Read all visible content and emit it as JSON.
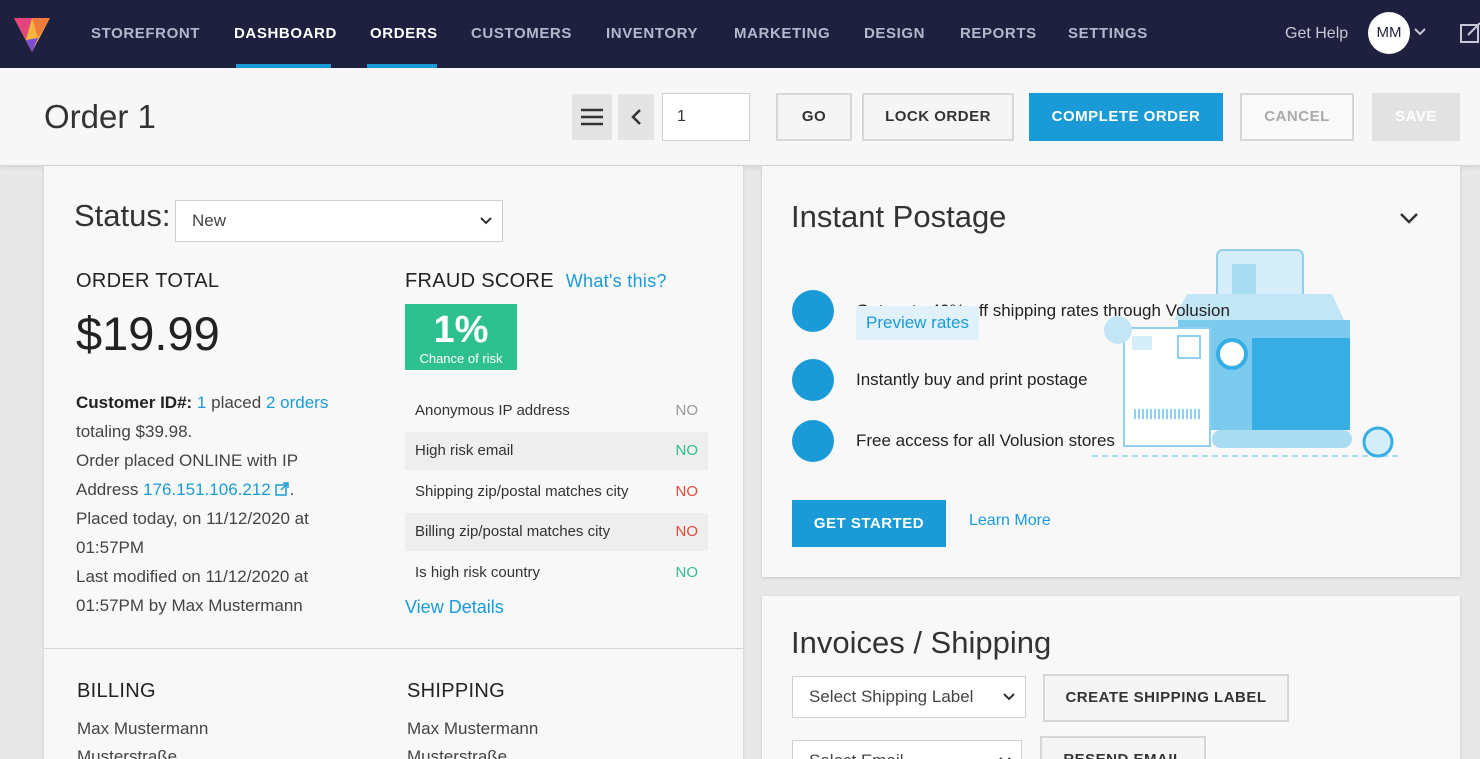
{
  "nav": {
    "items": [
      "STOREFRONT",
      "DASHBOARD",
      "ORDERS",
      "CUSTOMERS",
      "INVENTORY",
      "MARKETING",
      "DESIGN",
      "REPORTS",
      "SETTINGS"
    ],
    "get_help": "Get Help",
    "avatar_initials": "MM"
  },
  "header": {
    "title": "Order 1",
    "order_number_value": "1",
    "go": "GO",
    "lock_order": "LOCK ORDER",
    "complete_order": "COMPLETE ORDER",
    "cancel": "CANCEL",
    "save": "SAVE"
  },
  "order": {
    "status_label": "Status:",
    "status_value": "New",
    "total_heading": "ORDER TOTAL",
    "total": "$19.99",
    "customer_label": "Customer ID#:",
    "customer_id": "1",
    "placed_word": "placed",
    "orders_link": "2 orders",
    "totaling": "totaling $39.98.",
    "placed_line": "Order placed ONLINE with IP",
    "address_word": "Address",
    "ip": "176.151.106.212",
    "placed_date_1": "Placed today, on 11/12/2020 at",
    "placed_date_2": "01:57PM",
    "modified_1": "Last modified on 11/12/2020 at",
    "modified_2": "01:57PM by Max Mustermann"
  },
  "fraud": {
    "heading": "FRAUD SCORE",
    "whats_this": "What's this?",
    "percent": "1%",
    "sub": "Chance of risk",
    "rows": [
      {
        "label": "Anonymous IP address",
        "value": "NO"
      },
      {
        "label": "High risk email",
        "value": "NO"
      },
      {
        "label": "Shipping zip/postal matches city",
        "value": "NO"
      },
      {
        "label": "Billing zip/postal matches city",
        "value": "NO"
      },
      {
        "label": "Is high risk country",
        "value": "NO"
      }
    ],
    "view_details": "View Details"
  },
  "billing": {
    "heading": "BILLING",
    "name": "Max Mustermann",
    "street": "Musterstraße"
  },
  "shipping": {
    "heading": "SHIPPING",
    "name": "Max Mustermann",
    "street": "Musterstraße"
  },
  "postage": {
    "title": "Instant Postage",
    "features": [
      "Get up to 40% off shipping rates through Volusion",
      "Instantly buy and print postage",
      "Free access for all Volusion stores"
    ],
    "preview_rates": "Preview rates",
    "get_started": "GET STARTED",
    "learn_more": "Learn More"
  },
  "invoices": {
    "title": "Invoices / Shipping",
    "select_label": "Select Shipping Label",
    "create_label": "CREATE SHIPPING LABEL",
    "select_email": "Select Email",
    "resend_email": "RESEND EMAIL"
  },
  "colors": {
    "nav_bg": "#1f2040",
    "accent": "#1a9bd7",
    "green": "#2ec08e",
    "red": "#e14a3b"
  }
}
